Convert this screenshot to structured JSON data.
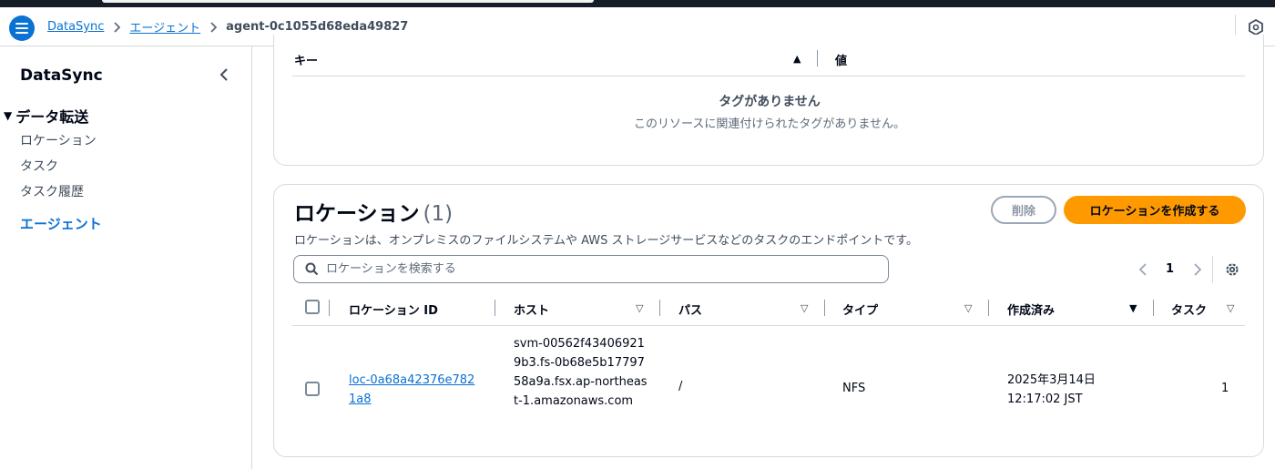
{
  "header": {
    "breadcrumbs": [
      "DataSync",
      "エージェント"
    ],
    "current": "agent-0c1055d68eda49827"
  },
  "sidebar": {
    "title": "DataSync",
    "section": "データ転送",
    "items": [
      {
        "label": "ロケーション",
        "active": false
      },
      {
        "label": "タスク",
        "active": false
      },
      {
        "label": "タスク履歴",
        "active": false
      },
      {
        "label": "エージェント",
        "active": true
      }
    ]
  },
  "tags": {
    "columns": {
      "key": "キー",
      "value": "値"
    },
    "empty_title": "タグがありません",
    "empty_text": "このリソースに関連付けられたタグがありません。"
  },
  "locations": {
    "title": "ロケーション",
    "count": "(1)",
    "description": "ロケーションは、オンプレミスのファイルシステムや AWS ストレージサービスなどのタスクのエンドポイントです。",
    "delete_label": "削除",
    "create_label": "ロケーションを作成する",
    "search_placeholder": "ロケーションを検索する",
    "page": "1",
    "columns": [
      "ロケーション ID",
      "ホスト",
      "パス",
      "タイプ",
      "作成済み",
      "タスク"
    ],
    "rows": [
      {
        "id": "loc-0a68a42376e7821a8",
        "host": "svm-00562f434069219b3.fs-0b68e5b1779758a9a.fsx.ap-northeast-1.amazonaws.com",
        "path": "/",
        "type": "NFS",
        "created_date": "2025年3月14日",
        "created_time": "12:17:02 JST",
        "tasks": "1"
      }
    ]
  },
  "colors": {
    "accent": "#0972d3",
    "primary_button": "#ff9900",
    "border": "#d5dbdb"
  },
  "icons": [
    "menu-icon",
    "chevron-right-icon",
    "notifications-icon",
    "chevron-left-icon",
    "caret-down-icon",
    "sort-ascending-icon",
    "sort-icon",
    "search-icon",
    "settings-gear-icon"
  ]
}
